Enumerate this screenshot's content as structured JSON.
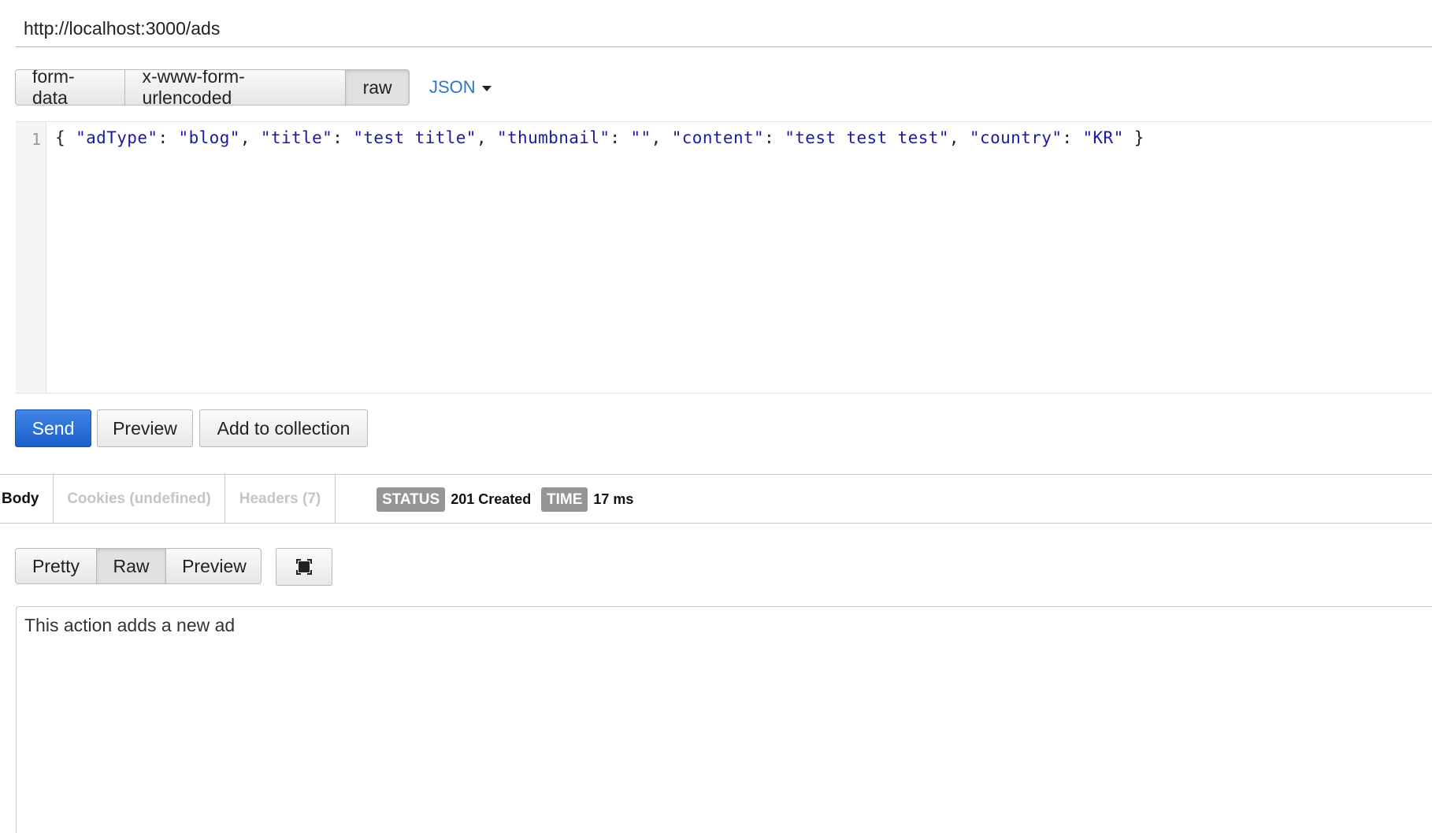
{
  "request": {
    "url": "http://localhost:3000/ads",
    "body_modes": [
      "form-data",
      "x-www-form-urlencoded",
      "raw"
    ],
    "active_body_mode": "raw",
    "format": "JSON",
    "line_number": "1",
    "code": {
      "open": "{ ",
      "pairs": [
        {
          "key": "\"adType\"",
          "value": "\"blog\""
        },
        {
          "key": "\"title\"",
          "value": "\"test title\""
        },
        {
          "key": "\"thumbnail\"",
          "value": "\"\""
        },
        {
          "key": "\"content\"",
          "value": "\"test test test\""
        },
        {
          "key": "\"country\"",
          "value": "\"KR\""
        }
      ],
      "close": " }"
    }
  },
  "actions": {
    "send_label": "Send",
    "preview_label": "Preview",
    "add_label": "Add to collection"
  },
  "response": {
    "tabs": [
      "Body",
      "Cookies (undefined)",
      "Headers (7)"
    ],
    "active_tab": "Body",
    "status_label": "STATUS",
    "status_value": "201 Created",
    "time_label": "TIME",
    "time_value": "17 ms",
    "view_modes": [
      "Pretty",
      "Raw",
      "Preview"
    ],
    "active_view": "Raw",
    "fullscreen_icon": "fullscreen-icon",
    "body_text": "This action adds a new ad"
  },
  "colors": {
    "primary": "#1a5ec9",
    "link": "#2a79c2",
    "json_string": "#1a1aa6",
    "badge": "#959595"
  }
}
